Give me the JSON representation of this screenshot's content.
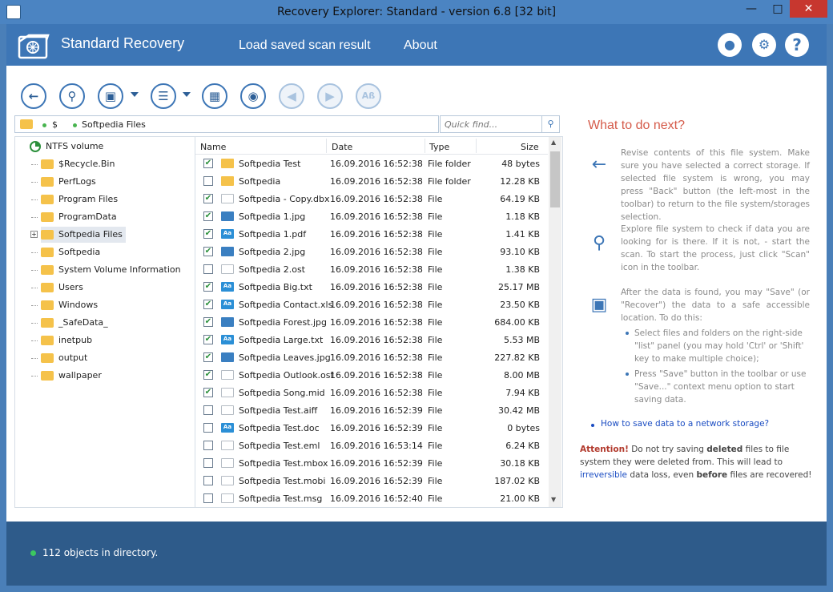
{
  "window": {
    "title": "Recovery Explorer: Standard - version 6.8 [32 bit]"
  },
  "header": {
    "brand": "Standard Recovery",
    "nav": [
      {
        "label": "Load saved scan result"
      },
      {
        "label": "About"
      }
    ]
  },
  "toolbar": {
    "buttons": [
      "back-icon",
      "scan-icon",
      "save-icon",
      "list-select-icon",
      "layout-icon",
      "binoculars-icon",
      "prev-icon",
      "next-icon",
      "match-case-icon"
    ],
    "ab_label": "Aß"
  },
  "path": {
    "segment1": "$",
    "segment2": "Softpedia Files"
  },
  "search": {
    "placeholder": "Quick find..."
  },
  "tree": {
    "root": "NTFS volume",
    "items": [
      {
        "label": "$Recycle.Bin"
      },
      {
        "label": "PerfLogs"
      },
      {
        "label": "Program Files"
      },
      {
        "label": "ProgramData"
      },
      {
        "label": "Softpedia Files"
      },
      {
        "label": "Softpedia"
      },
      {
        "label": "System Volume Information"
      },
      {
        "label": "Users"
      },
      {
        "label": "Windows"
      },
      {
        "label": "_SafeData_"
      },
      {
        "label": "inetpub"
      },
      {
        "label": "output"
      },
      {
        "label": "wallpaper"
      }
    ]
  },
  "list": {
    "columns": {
      "name": "Name",
      "date": "Date",
      "type": "Type",
      "size": "Size"
    },
    "rows": [
      {
        "checked": true,
        "icon": "folder",
        "name": "Softpedia Test",
        "date": "16.09.2016 16:52:38",
        "type": "File folder",
        "size": "48 bytes"
      },
      {
        "checked": false,
        "icon": "folder",
        "name": "Softpedia",
        "date": "16.09.2016 16:52:38",
        "type": "File folder",
        "size": "12.28 KB"
      },
      {
        "checked": true,
        "icon": "file",
        "name": "Softpedia - Copy.dbx",
        "date": "16.09.2016 16:52:38",
        "type": "File",
        "size": "64.19 KB"
      },
      {
        "checked": true,
        "icon": "img",
        "name": "Softpedia 1.jpg",
        "date": "16.09.2016 16:52:38",
        "type": "File",
        "size": "1.18 KB"
      },
      {
        "checked": true,
        "icon": "txt",
        "name": "Softpedia 1.pdf",
        "date": "16.09.2016 16:52:38",
        "type": "File",
        "size": "1.41 KB"
      },
      {
        "checked": true,
        "icon": "img",
        "name": "Softpedia 2.jpg",
        "date": "16.09.2016 16:52:38",
        "type": "File",
        "size": "93.10 KB"
      },
      {
        "checked": false,
        "icon": "file",
        "name": "Softpedia 2.ost",
        "date": "16.09.2016 16:52:38",
        "type": "File",
        "size": "1.38 KB"
      },
      {
        "checked": true,
        "icon": "txt",
        "name": "Softpedia Big.txt",
        "date": "16.09.2016 16:52:38",
        "type": "File",
        "size": "25.17 MB"
      },
      {
        "checked": true,
        "icon": "txt",
        "name": "Softpedia Contact.xls",
        "date": "16.09.2016 16:52:38",
        "type": "File",
        "size": "23.50 KB"
      },
      {
        "checked": true,
        "icon": "img",
        "name": "Softpedia Forest.jpg",
        "date": "16.09.2016 16:52:38",
        "type": "File",
        "size": "684.00 KB"
      },
      {
        "checked": true,
        "icon": "txt",
        "name": "Softpedia Large.txt",
        "date": "16.09.2016 16:52:38",
        "type": "File",
        "size": "5.53 MB"
      },
      {
        "checked": true,
        "icon": "img",
        "name": "Softpedia Leaves.jpg",
        "date": "16.09.2016 16:52:38",
        "type": "File",
        "size": "227.82 KB"
      },
      {
        "checked": true,
        "icon": "file",
        "name": "Softpedia Outlook.ost",
        "date": "16.09.2016 16:52:38",
        "type": "File",
        "size": "8.00 MB"
      },
      {
        "checked": true,
        "icon": "file",
        "name": "Softpedia Song.mid",
        "date": "16.09.2016 16:52:38",
        "type": "File",
        "size": "7.94 KB"
      },
      {
        "checked": false,
        "icon": "file",
        "name": "Softpedia Test.aiff",
        "date": "16.09.2016 16:52:39",
        "type": "File",
        "size": "30.42 MB"
      },
      {
        "checked": false,
        "icon": "txt",
        "name": "Softpedia Test.doc",
        "date": "16.09.2016 16:52:39",
        "type": "File",
        "size": "0 bytes"
      },
      {
        "checked": false,
        "icon": "file",
        "name": "Softpedia Test.eml",
        "date": "16.09.2016 16:53:14",
        "type": "File",
        "size": "6.24 KB"
      },
      {
        "checked": false,
        "icon": "file",
        "name": "Softpedia Test.mbox",
        "date": "16.09.2016 16:52:39",
        "type": "File",
        "size": "30.18 KB"
      },
      {
        "checked": false,
        "icon": "file",
        "name": "Softpedia Test.mobi",
        "date": "16.09.2016 16:52:39",
        "type": "File",
        "size": "187.02 KB"
      },
      {
        "checked": false,
        "icon": "file",
        "name": "Softpedia Test.msg",
        "date": "16.09.2016 16:52:40",
        "type": "File",
        "size": "21.00 KB"
      }
    ]
  },
  "help": {
    "title": "What to do next?",
    "p1": "Revise contents of this file system. Make sure you have selected a correct storage. If selected file system is wrong, you may press \"Back\" button (the left-most in the toolbar) to return to the file system/storages selection.",
    "p2": "Explore file system to check if data you are looking for is there. If it is not, - start the scan. To start the process, just click \"Scan\" icon in the toolbar.",
    "p3": "After the data is found, you may \"Save\" (or \"Recover\") the data to a safe accessible location. To do this:",
    "b1": "Select files and folders on the right-side \"list\" panel (you may hold 'Ctrl' or 'Shift' key to make multiple choice);",
    "b2": "Press \"Save\" button in the toolbar or use \"Save...\" context menu option to start saving data.",
    "link": "How to save data to a network storage?",
    "attention": {
      "a1": "Attention!",
      "a2": " Do not try saving ",
      "a3": "deleted",
      "a4": " files to file system they were deleted from. This will lead to ",
      "a5": "irreversible",
      "a6": " data loss, even ",
      "a7": "before",
      "a8": " files are recovered!"
    }
  },
  "status": {
    "text": "112 objects in directory."
  }
}
